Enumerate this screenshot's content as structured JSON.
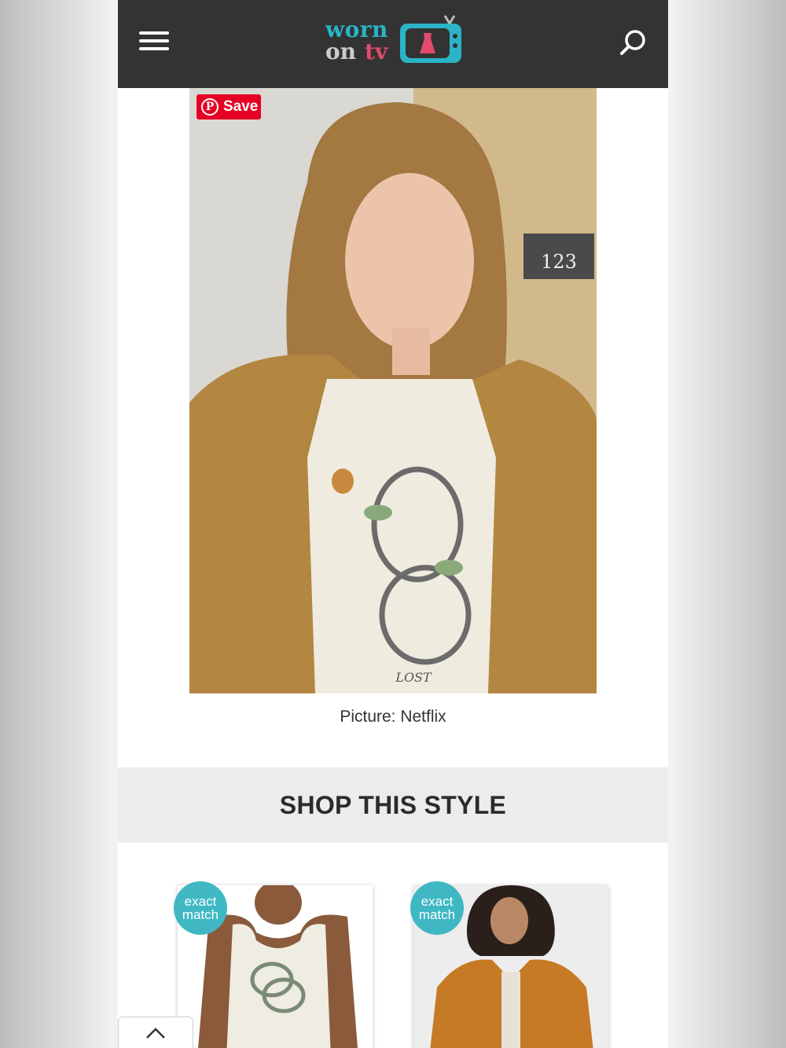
{
  "header": {
    "menu_icon": "hamburger-menu-icon",
    "logo": {
      "line1": "worn",
      "line2_a": "on",
      "line2_b": "tv",
      "icon": "tv-dress-icon"
    },
    "search_icon": "search-icon",
    "background": "#333333"
  },
  "hero": {
    "save_label": "Save",
    "caption": "Picture: Netflix"
  },
  "shop": {
    "title": "SHOP THIS STYLE",
    "products": [
      {
        "badge_line1": "exact",
        "badge_line2": "match"
      },
      {
        "badge_line1": "exact",
        "badge_line2": "match"
      }
    ]
  },
  "scroll_top_icon": "chevron-up-icon",
  "colors": {
    "accent": "#3fb8c4",
    "pinterest": "#e60023",
    "logo_blue": "#2ab4c6",
    "logo_pink": "#e34a6b"
  }
}
